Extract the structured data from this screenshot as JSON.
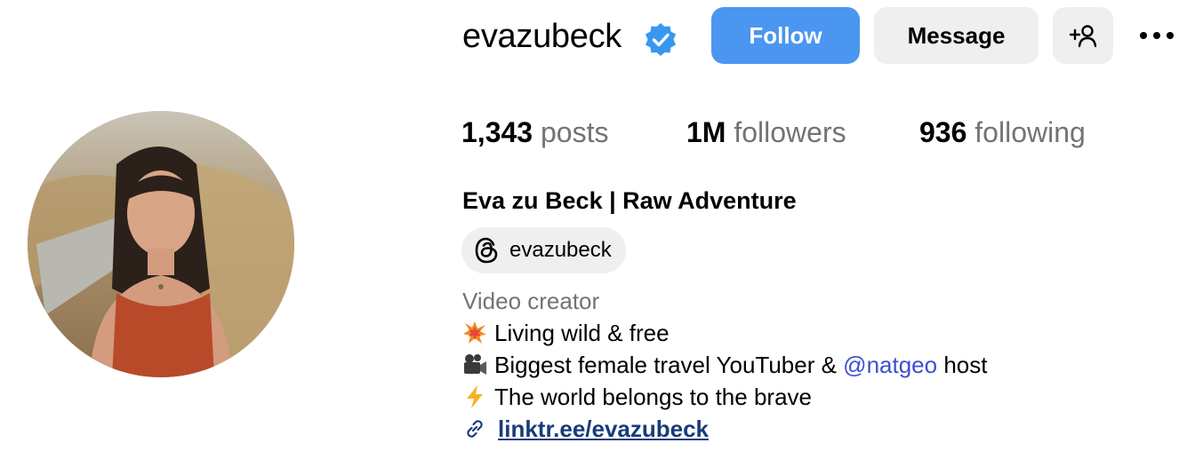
{
  "profile": {
    "username": "evazubeck",
    "verified": true,
    "full_name": "Eva zu Beck | Raw Adventure",
    "threads_handle": "evazubeck",
    "category": "Video creator"
  },
  "actions": {
    "follow_label": "Follow",
    "message_label": "Message",
    "add_user_icon": "add-user-icon",
    "more_icon": "more-options-icon"
  },
  "stats": {
    "posts_count": "1,343",
    "posts_label": "posts",
    "followers_count": "1M",
    "followers_label": "followers",
    "following_count": "936",
    "following_label": "following"
  },
  "bio": {
    "line1": {
      "icon": "collision-emoji",
      "text": "Living wild & free"
    },
    "line2": {
      "icon": "video-camera-emoji",
      "text_before": "Biggest female travel YouTuber & ",
      "mention": "@natgeo",
      "text_after": " host"
    },
    "line3": {
      "icon": "lightning-emoji",
      "text": "The world belongs to the brave"
    },
    "link": {
      "icon": "link-icon",
      "text": "linktr.ee/evazubeck"
    }
  },
  "colors": {
    "follow_button": "#4a96f0",
    "secondary_button": "#efefef",
    "verified_badge": "#3897f0",
    "muted_text": "#737373",
    "mention": "#3d4fd1",
    "link": "#173d7a"
  }
}
